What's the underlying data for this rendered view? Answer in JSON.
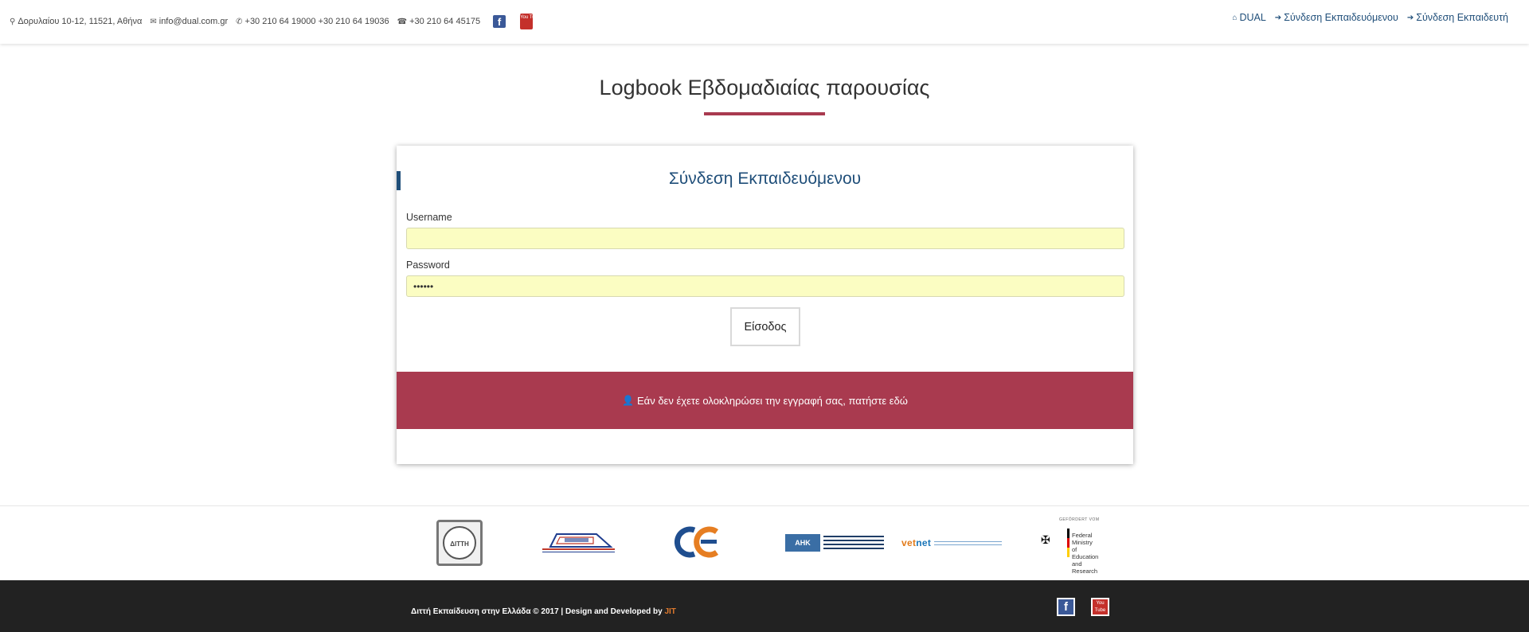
{
  "topbar": {
    "address": "Δορυλαίου 10-12, 11521, Αθήνα",
    "email": "info@dual.com.gr",
    "phones": "+30 210 64 19000  +30 210 64 19036",
    "fax": "+30 210 64 45175",
    "youtube_text": "You Tube",
    "nav": {
      "home": "DUAL",
      "student_login": "Σύνδεση Εκπαιδευόμενου",
      "trainer_login": "Σύνδεση Εκπαιδευτή"
    }
  },
  "page": {
    "title": "Logbook Εβδομαδιαίας παρουσίας"
  },
  "login": {
    "title": "Σύνδεση Εκπαιδευόμενου",
    "username_label": "Username",
    "username_value": "",
    "password_label": "Password",
    "password_value": "••••••",
    "submit_label": "Είσοδος",
    "register_text": "Εάν δεν έχετε ολοκληρώσει την εγγραφή σας, πατήστε εδώ"
  },
  "logos": {
    "ditth": "ΔΙΤΤΗ",
    "ahk": "AHK",
    "vetnet_prefix": "vet",
    "vetnet_suffix": "net",
    "bmbf_top": "GEFÖRDERT VOM",
    "bmbf_line1": "Federal Ministry",
    "bmbf_line2": "of Education",
    "bmbf_line3": "and Research"
  },
  "footer": {
    "copyright": "Διττή Εκπαίδευση στην Ελλάδα © 2017 | Design and Developed by ",
    "developer": "JIT",
    "youtube_text": "You Tube"
  },
  "colors": {
    "accent": "#a93a4f",
    "navy": "#1f4e79",
    "footer_bg": "#222222",
    "input_bg": "#fbfdc2"
  }
}
